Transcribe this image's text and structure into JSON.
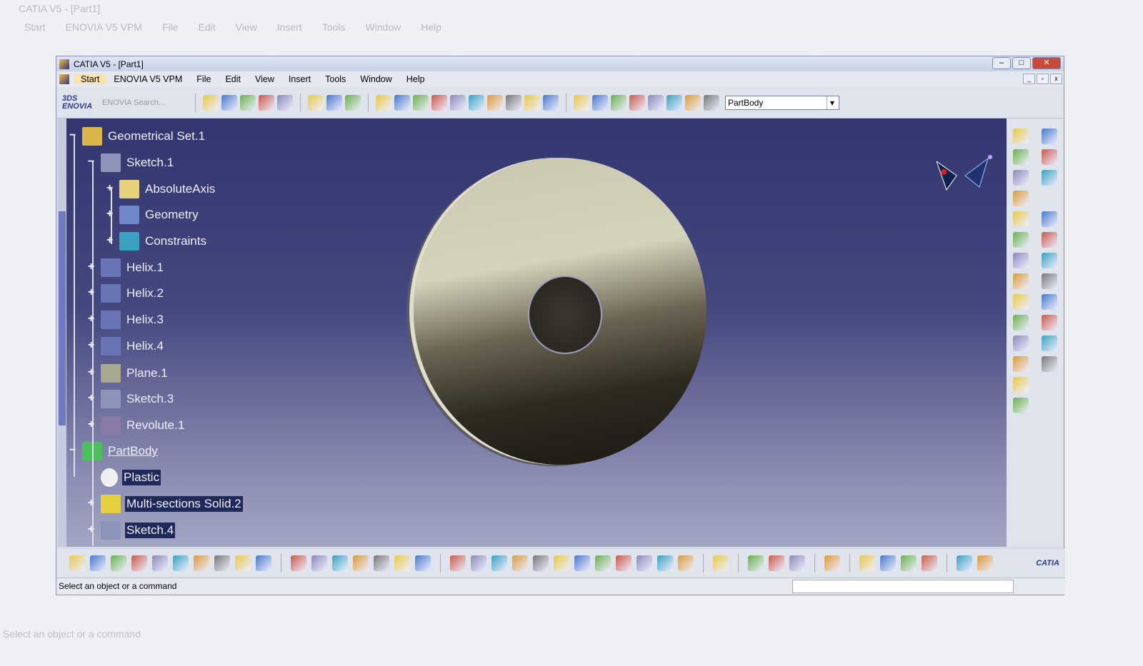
{
  "outer": {
    "title": "CATIA V5 - [Part1]",
    "menu": [
      "Start",
      "ENOVIA V5 VPM",
      "File",
      "Edit",
      "View",
      "Insert",
      "Tools",
      "Window",
      "Help"
    ],
    "status": "Select an object or a command"
  },
  "window": {
    "title": "CATIA V5 - [Part1]",
    "controls": {
      "minimize": "–",
      "maximize": "□",
      "close": "✕"
    },
    "menu": [
      "Start",
      "ENOVIA V5 VPM",
      "File",
      "Edit",
      "View",
      "Insert",
      "Tools",
      "Window",
      "Help"
    ]
  },
  "toolbar": {
    "enovia_logo": "ENOVIA",
    "enovia_search": "ENOVIA Search...",
    "body_select": "PartBody",
    "icons_left": [
      "enovia-link-icon",
      "enovia-tree-icon",
      "enovia-doc-icon",
      "enovia-copy-icon",
      "enovia-sync-icon"
    ],
    "icons_wire": [
      "point-icon",
      "line-icon",
      "plane-icon"
    ],
    "icons_solid": [
      "pad-icon",
      "pocket-icon",
      "shaft-icon",
      "groove-icon",
      "hole-icon",
      "rib-icon",
      "slot-icon",
      "multisection-icon",
      "stiffener-icon",
      "loft-removed-icon"
    ],
    "icons_right": [
      "update-icon",
      "rotate-icon",
      "axis-icon",
      "measure-icon",
      "boolean-icon",
      "constraint-icon",
      "list-icon",
      "body-icon"
    ]
  },
  "tree": [
    {
      "label": "Geometrical Set.1",
      "level": 0,
      "sign": "−",
      "color": "#d9b54a"
    },
    {
      "label": "Sketch.1",
      "level": 1,
      "sign": "−",
      "color": "#8b94b8"
    },
    {
      "label": "AbsoluteAxis",
      "level": 2,
      "sign": "+",
      "color": "#e6d27a"
    },
    {
      "label": "Geometry",
      "level": 2,
      "sign": "+",
      "color": "#6f86c8"
    },
    {
      "label": "Constraints",
      "level": 2,
      "sign": "+",
      "color": "#3aa0c0"
    },
    {
      "label": "Helix.1",
      "level": 1,
      "sign": "+",
      "color": "#6a75b8"
    },
    {
      "label": "Helix.2",
      "level": 1,
      "sign": "+",
      "color": "#6a75b8"
    },
    {
      "label": "Helix.3",
      "level": 1,
      "sign": "+",
      "color": "#6a75b8"
    },
    {
      "label": "Helix.4",
      "level": 1,
      "sign": "+",
      "color": "#6a75b8"
    },
    {
      "label": "Plane.1",
      "level": 1,
      "sign": "+",
      "color": "#a8a890"
    },
    {
      "label": "Sketch.3",
      "level": 1,
      "sign": "+",
      "color": "#8b94b8"
    },
    {
      "label": "Revolute.1",
      "level": 1,
      "sign": "+",
      "color": "#8a7aa8"
    },
    {
      "label": "PartBody",
      "level": 0,
      "sign": "−",
      "color": "#4cc05a",
      "underline": true
    },
    {
      "label": "Plastic",
      "level": 1,
      "sign": "",
      "color": "#f0f0f0",
      "selected": true
    },
    {
      "label": "Multi-sections Solid.2",
      "level": 1,
      "sign": "+",
      "color": "#e6d040",
      "selected": true
    },
    {
      "label": "Sketch.4",
      "level": 1,
      "sign": "+",
      "color": "#8b94b8",
      "selected": true
    }
  ],
  "right_toolbar": [
    "view-pad-icon",
    "gear-icon",
    "cube-yellow-icon",
    "options-icon",
    "cube-icon",
    "tree-icon",
    "wedge-icon",
    "separator",
    "box-icon",
    "select-arrow-icon",
    "target-icon",
    "sketch-icon",
    "red-box-icon",
    "green-box-icon",
    "frame-icon",
    "red-sphere-icon",
    "frame2-icon",
    "green-sphere-icon",
    "measure-icon",
    "abc-text-icon",
    "bars-icon",
    "arrow-annot-icon",
    "grid-icon",
    "material-icon",
    "fit-icon",
    "blank",
    "cube-small-icon",
    "blank"
  ],
  "bottom_toolbar": [
    "new-icon",
    "open-icon",
    "save-icon",
    "print-icon",
    "cut-icon",
    "copy-icon",
    "paste-icon",
    "undo-icon",
    "redo-icon",
    "help-icon",
    "sep",
    "formula-icon",
    "comment-icon",
    "link-icon",
    "table-icon",
    "hierarchy-icon",
    "lock-icon",
    "equals-icon",
    "sep",
    "fly-icon",
    "fit-all-icon",
    "pan-icon",
    "rotate-icon",
    "zoom-in-icon",
    "zoom-out-icon",
    "normal-view-icon",
    "multiview-icon",
    "iso-view-icon",
    "hide-show-icon",
    "swap-icon",
    "render-icon",
    "sep",
    "catalog-icon",
    "sep",
    "measure-between-icon",
    "measure-item-icon",
    "inertia-icon",
    "sep",
    "camera-icon",
    "sep",
    "apply-material-icon",
    "map-icon",
    "texture-icon",
    "layer-icon",
    "sep",
    "sheet-icon",
    "swap-visible-icon"
  ],
  "bottom_logo": "CATIA",
  "status": "Select an object or a command",
  "colors": {
    "viewport_top": "#33366f",
    "viewport_bottom": "#a3a5c3",
    "selection": "#202a5a"
  }
}
